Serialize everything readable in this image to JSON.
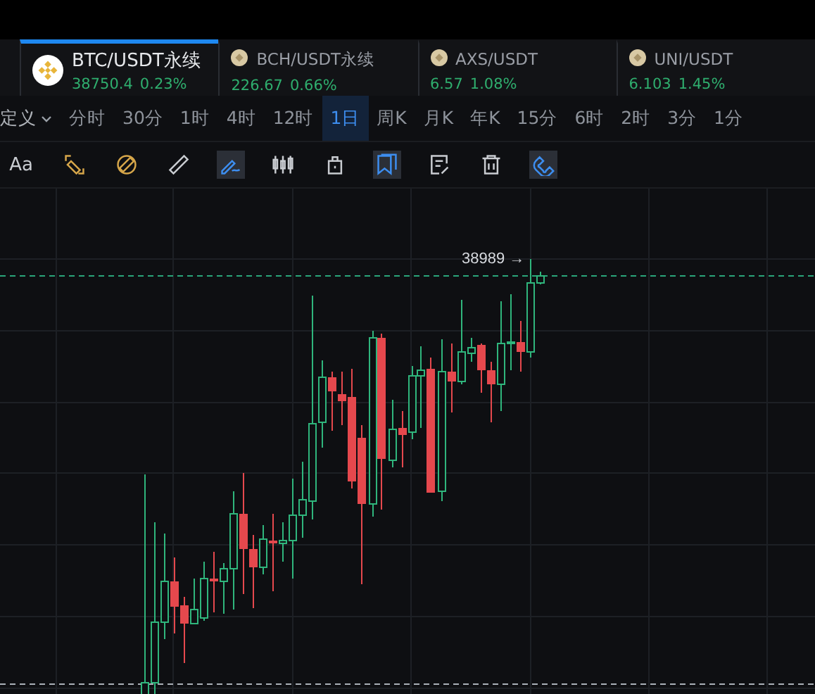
{
  "tickers": [
    {
      "symbol": "BTC/USDT永续",
      "price": "38750.4",
      "change": "0.23%",
      "selected": true
    },
    {
      "symbol": "BCH/USDT永续",
      "price": "226.67",
      "change": "0.66%",
      "selected": false
    },
    {
      "symbol": "AXS/USDT",
      "price": "6.57",
      "change": "1.08%",
      "selected": false
    },
    {
      "symbol": "UNI/USDT",
      "price": "6.103",
      "change": "1.45%",
      "selected": false
    }
  ],
  "custom_menu": {
    "label": "定义"
  },
  "timeframes": [
    {
      "label": "分时",
      "selected": false
    },
    {
      "label": "30分",
      "selected": false
    },
    {
      "label": "1时",
      "selected": false
    },
    {
      "label": "4时",
      "selected": false
    },
    {
      "label": "12时",
      "selected": false
    },
    {
      "label": "1日",
      "selected": true
    },
    {
      "label": "周K",
      "selected": false
    },
    {
      "label": "月K",
      "selected": false
    },
    {
      "label": "年K",
      "selected": false
    },
    {
      "label": "15分",
      "selected": false
    },
    {
      "label": "6时",
      "selected": false
    },
    {
      "label": "2时",
      "selected": false
    },
    {
      "label": "3分",
      "selected": false
    },
    {
      "label": "1分",
      "selected": false
    }
  ],
  "tools": [
    {
      "kind": "text",
      "label": "Aa",
      "selected": false
    },
    {
      "kind": "icon",
      "selected": false
    },
    {
      "kind": "icon",
      "selected": false
    },
    {
      "kind": "icon",
      "selected": false
    },
    {
      "kind": "icon",
      "selected": true
    },
    {
      "kind": "icon",
      "selected": false
    },
    {
      "kind": "icon",
      "selected": false
    },
    {
      "kind": "icon",
      "selected": true
    },
    {
      "kind": "icon",
      "selected": false
    },
    {
      "kind": "icon",
      "selected": false
    },
    {
      "kind": "icon",
      "selected": true
    }
  ],
  "chart": {
    "high_label": "38989 →"
  }
}
